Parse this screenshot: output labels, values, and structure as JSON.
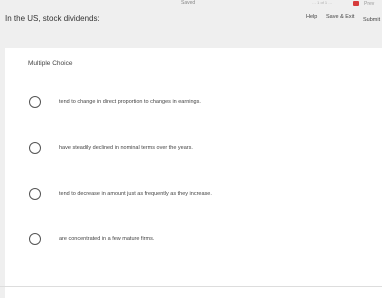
{
  "header": {
    "saved_label": "Saved",
    "progress_mini": "… 1 of 1 …",
    "prev_label": "Prev",
    "help_label": "Help",
    "save_exit_label": "Save & Exit",
    "submit_label": "Submit"
  },
  "question": {
    "text": "In the US, stock dividends:",
    "type_label": "Multiple Choice",
    "choices": [
      {
        "text": "tend to change in direct proportion to changes in earnings."
      },
      {
        "text": "have steadily declined in nominal terms over the years."
      },
      {
        "text": "tend to decrease in amount just as frequently as they increase."
      },
      {
        "text": "are concentrated in a few mature firms."
      }
    ]
  }
}
